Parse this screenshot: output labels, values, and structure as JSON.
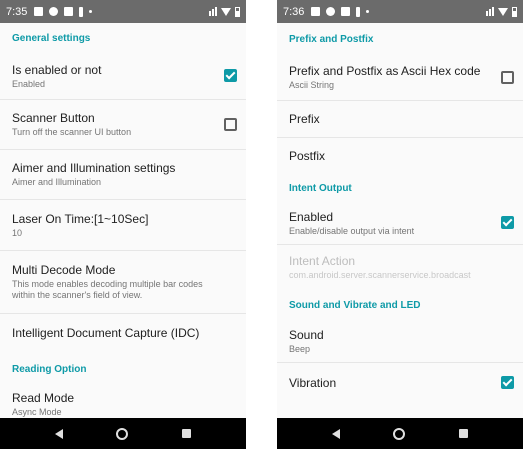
{
  "left": {
    "status_time": "7:35",
    "sections": [
      {
        "kind": "header",
        "label": "General settings"
      },
      {
        "kind": "row",
        "title": "Is enabled or not",
        "summary": "Enabled",
        "checkbox": "checked"
      },
      {
        "kind": "row",
        "title": "Scanner Button",
        "summary": "Turn off the scanner UI button",
        "checkbox": "unchecked"
      },
      {
        "kind": "row",
        "title": "Aimer and Illumination settings",
        "summary": "Aimer and Illumination"
      },
      {
        "kind": "row",
        "title": "Laser On Time:[1~10Sec]",
        "summary": "10"
      },
      {
        "kind": "row",
        "title": "Multi Decode Mode",
        "summary": "This mode enables decoding multiple bar codes within the scanner's field of view."
      },
      {
        "kind": "row",
        "title": "Intelligent Document Capture (IDC)",
        "summary": ""
      },
      {
        "kind": "header",
        "label": "Reading Option"
      },
      {
        "kind": "row",
        "title": "Read Mode",
        "summary": "Async Mode"
      }
    ]
  },
  "right": {
    "status_time": "7:36",
    "sections": [
      {
        "kind": "header",
        "label": "Prefix and Postfix"
      },
      {
        "kind": "row",
        "title": "Prefix and Postfix as Ascii Hex code",
        "summary": "Ascii String",
        "checkbox": "unchecked"
      },
      {
        "kind": "row",
        "title": "Prefix",
        "summary": ""
      },
      {
        "kind": "row",
        "title": "Postfix",
        "summary": ""
      },
      {
        "kind": "header",
        "label": "Intent Output"
      },
      {
        "kind": "row",
        "title": "Enabled",
        "summary": "Enable/disable output via intent",
        "checkbox": "checked"
      },
      {
        "kind": "row",
        "title": "Intent Action",
        "summary": "com.android.server.scannerservice.broadcast",
        "disabled": true
      },
      {
        "kind": "header",
        "label": "Sound and Vibrate and LED"
      },
      {
        "kind": "row",
        "title": "Sound",
        "summary": "Beep"
      },
      {
        "kind": "row",
        "title": "Vibration",
        "summary": "",
        "checkbox": "checked"
      }
    ]
  },
  "colors": {
    "accent": "#0e9aa7",
    "statusbar": "#6b6b6b",
    "navbar": "#000000"
  }
}
